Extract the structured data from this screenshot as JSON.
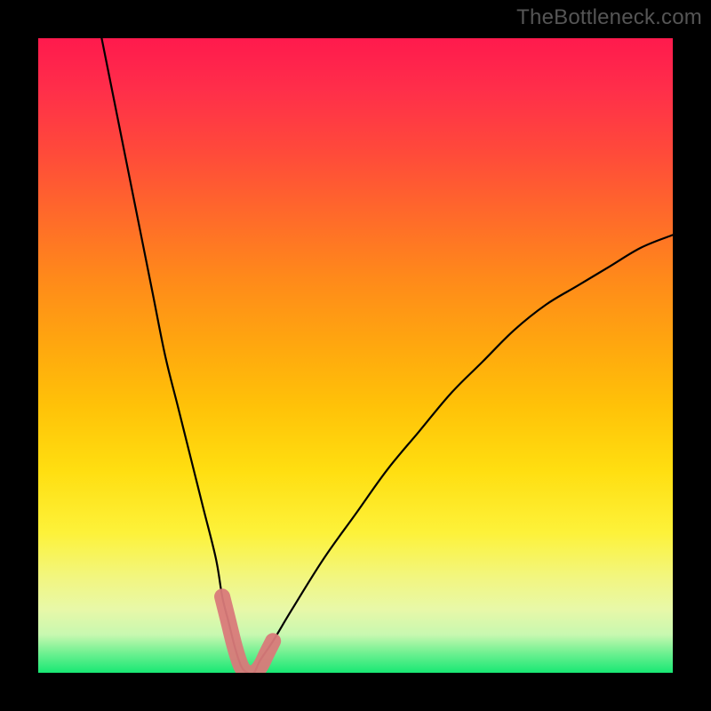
{
  "watermark": "TheBottleneck.com",
  "chart_data": {
    "type": "line",
    "title": "",
    "xlabel": "",
    "ylabel": "",
    "xlim": [
      0,
      100
    ],
    "ylim": [
      0,
      100
    ],
    "grid": false,
    "legend": false,
    "background_gradient": {
      "top": "#ff1a4d",
      "bottom": "#18e874"
    },
    "series": [
      {
        "name": "bottleneck-curve",
        "color": "#000000",
        "x": [
          10,
          12,
          14,
          16,
          18,
          20,
          22,
          24,
          26,
          28,
          29,
          30,
          31,
          32,
          33,
          34,
          35,
          37,
          40,
          45,
          50,
          55,
          60,
          65,
          70,
          75,
          80,
          85,
          90,
          95,
          100
        ],
        "y": [
          100,
          90,
          80,
          70,
          60,
          50,
          42,
          34,
          26,
          18,
          12,
          8,
          4,
          1,
          0,
          0,
          2,
          5,
          10,
          18,
          25,
          32,
          38,
          44,
          49,
          54,
          58,
          61,
          64,
          67,
          69
        ]
      },
      {
        "name": "highlight-band",
        "color": "#d97a7a",
        "x": [
          29,
          30,
          31,
          32,
          33,
          34,
          35,
          36,
          37
        ],
        "y": [
          12,
          8,
          4,
          1,
          0,
          0,
          1,
          3,
          5
        ]
      }
    ],
    "minimum_point": {
      "x": 33.5,
      "y": 0
    }
  }
}
